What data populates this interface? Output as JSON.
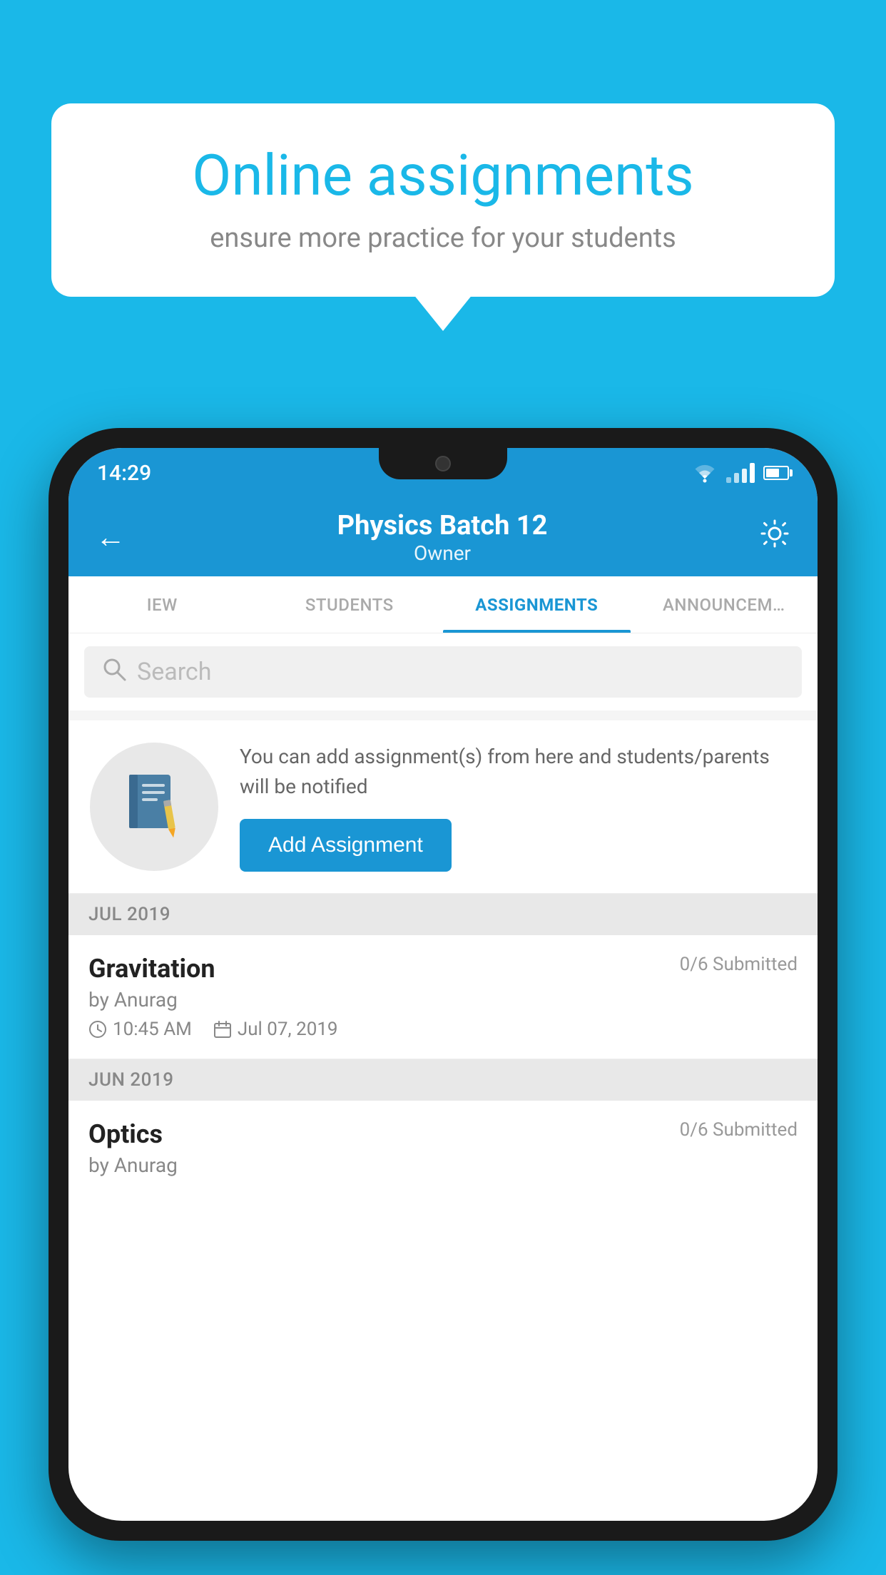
{
  "background_color": "#1ab8e8",
  "speech_bubble": {
    "title": "Online assignments",
    "subtitle": "ensure more practice for your students"
  },
  "phone": {
    "status_bar": {
      "time": "14:29"
    },
    "header": {
      "title": "Physics Batch 12",
      "subtitle": "Owner",
      "back_label": "←",
      "settings_label": "⚙"
    },
    "tabs": [
      {
        "label": "IEW",
        "active": false
      },
      {
        "label": "STUDENTS",
        "active": false
      },
      {
        "label": "ASSIGNMENTS",
        "active": true
      },
      {
        "label": "ANNOUNCEM…",
        "active": false
      }
    ],
    "search": {
      "placeholder": "Search"
    },
    "promo": {
      "description": "You can add assignment(s) from here and students/parents will be notified",
      "button_label": "Add Assignment"
    },
    "sections": [
      {
        "month": "JUL 2019",
        "assignments": [
          {
            "name": "Gravitation",
            "submitted": "0/6 Submitted",
            "by": "by Anurag",
            "time": "10:45 AM",
            "date": "Jul 07, 2019"
          }
        ]
      },
      {
        "month": "JUN 2019",
        "assignments": [
          {
            "name": "Optics",
            "submitted": "0/6 Submitted",
            "by": "by Anurag",
            "time": "",
            "date": ""
          }
        ]
      }
    ]
  }
}
